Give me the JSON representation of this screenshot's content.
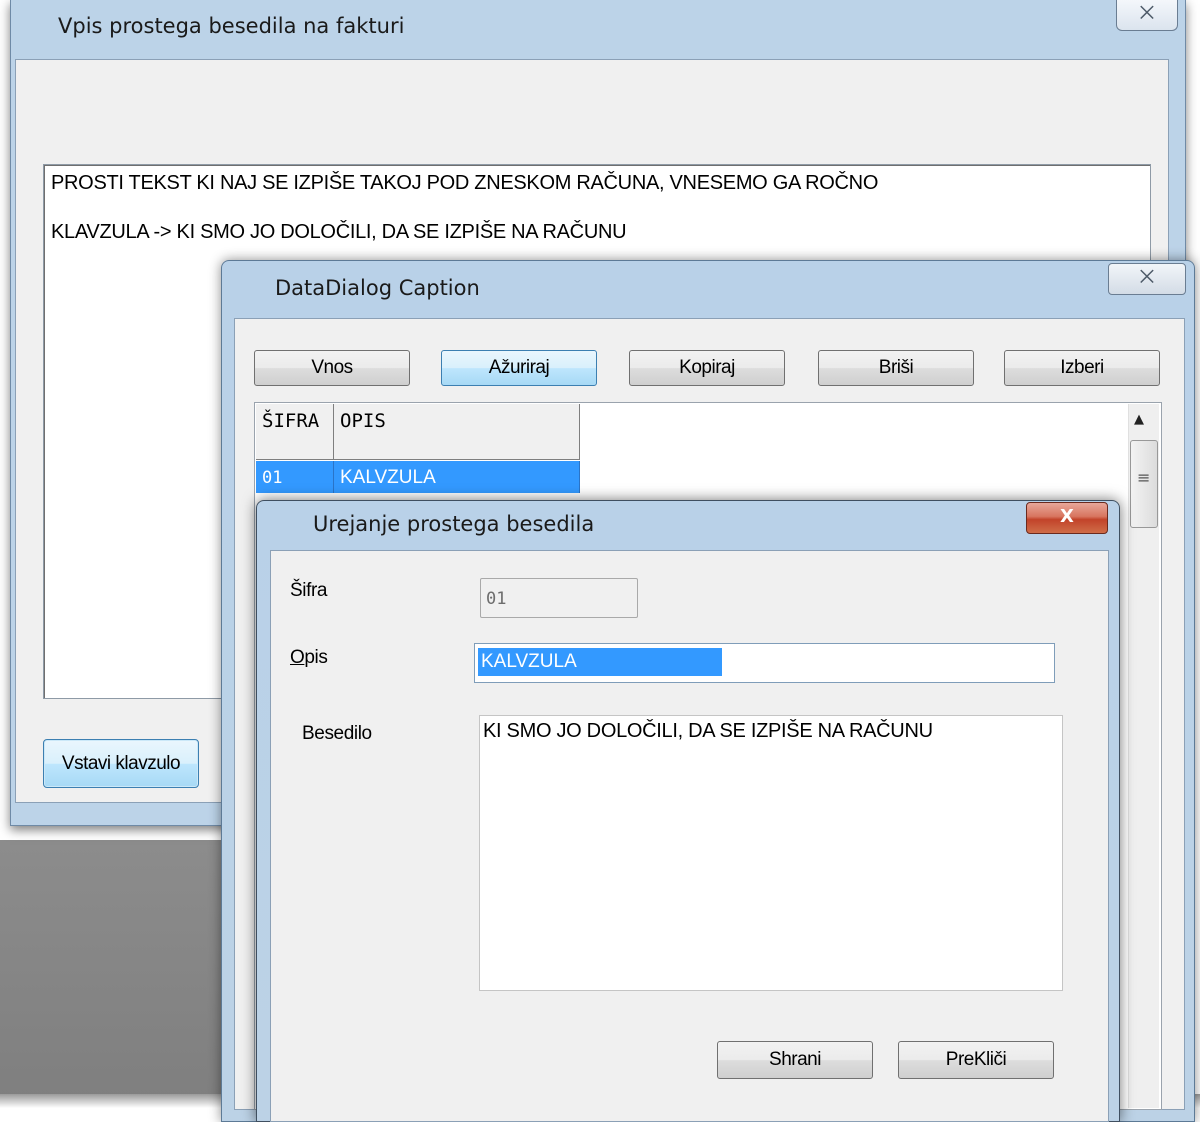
{
  "main_window": {
    "title": "Vpis prostega besedila na fakturi",
    "close_glyph": "⨉",
    "text_lines": [
      "PROSTI TEKST KI NAJ SE IZPIŠE TAKOJ POD ZNESKOM RAČUNA, VNESEMO GA ROČNO",
      "KLAVZULA -> KI SMO JO DOLOČILI, DA SE IZPIŠE NA RAČUNU"
    ],
    "insert_button": "Vstavi klavzulo"
  },
  "data_dialog": {
    "title": "DataDialog Caption",
    "close_glyph": "⨉",
    "toolbar": [
      "Vnos",
      "Ažuriraj",
      "Kopiraj",
      "Briši",
      "Izberi"
    ],
    "columns": [
      "ŠIFRA",
      "OPIS"
    ],
    "rows": [
      {
        "sifra": "01",
        "opis": "KALVZULA"
      }
    ]
  },
  "edit_dialog": {
    "title": "Urejanje prostega besedila",
    "close_glyph": "X",
    "sifra_label": "Šifra",
    "sifra_value": "01",
    "opis_label_first": "O",
    "opis_label_rest": "pis",
    "opis_value": "KALVZULA",
    "besedilo_label": "Besedilo",
    "besedilo_value": "KI SMO JO DOLOČILI, DA SE IZPIŠE NA RAČUNU",
    "save_button": "Shrani",
    "cancel_button": "PreKliči"
  },
  "colors": {
    "selection": "#3399ff",
    "window_frame": "#bcd3e8",
    "close_red": "#c2432a"
  }
}
